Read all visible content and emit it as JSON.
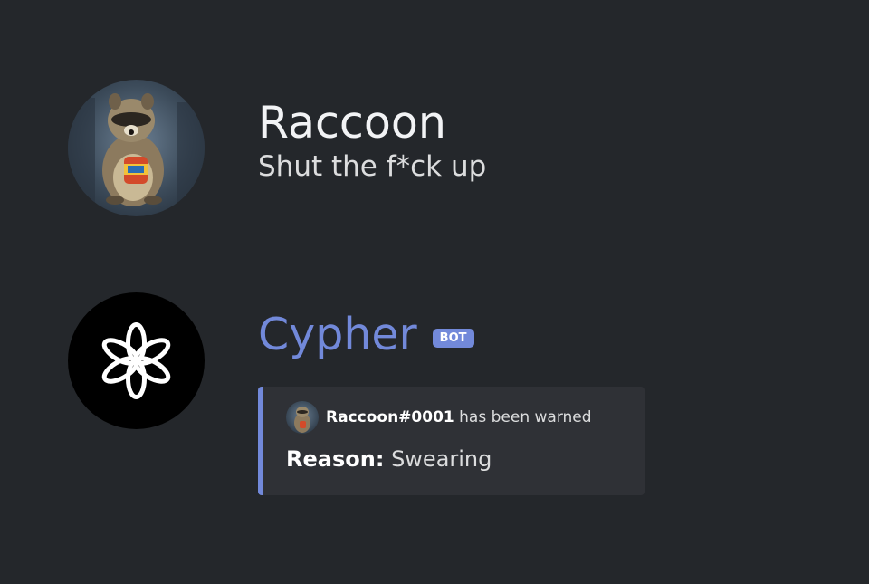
{
  "messages": [
    {
      "username": "Raccoon",
      "content": "Shut the f*ck up",
      "avatar": "raccoon-avatar"
    },
    {
      "username": "Cypher",
      "bot_tag": "BOT",
      "avatar": "openai-logo-avatar",
      "embed": {
        "author_name": "Raccoon#0001",
        "author_suffix": "has been warned",
        "field_name": "Reason:",
        "field_value": "Swearing"
      }
    }
  ],
  "colors": {
    "background": "#24272b",
    "bot_accent": "#7289da",
    "embed_background": "#2f3136"
  }
}
